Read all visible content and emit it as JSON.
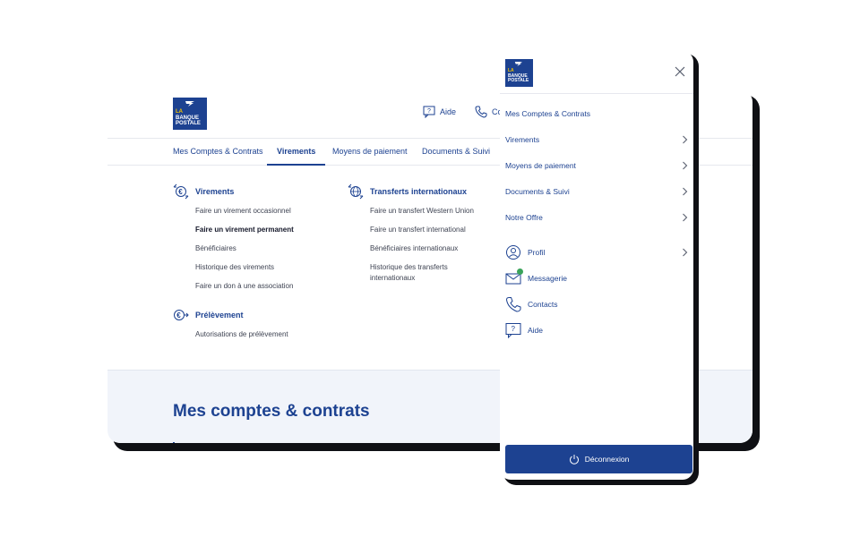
{
  "brand": {
    "logo_line1": "LA",
    "logo_line2": "BANQUE",
    "logo_line3": "POSTALE"
  },
  "desktop": {
    "header": {
      "help_label": "Aide",
      "contacts_label": "Co"
    },
    "nav": [
      {
        "label": "Mes Comptes & Contrats"
      },
      {
        "label": "Virements"
      },
      {
        "label": "Moyens de paiement"
      },
      {
        "label": "Documents & Suivi"
      }
    ],
    "menu": {
      "virements": {
        "title": "Virements",
        "links": [
          "Faire un virement occasionnel",
          "Faire un virement permanent",
          "Bénéficiaires",
          "Historique des virements",
          "Faire un don à une association"
        ]
      },
      "prelevement": {
        "title": "Prélèvement",
        "links": [
          "Autorisations de prélèvement"
        ]
      },
      "international": {
        "title": "Transferts internationaux",
        "links": [
          "Faire un transfert Western Union",
          "Faire un transfert international",
          "Bénéficiaires internationaux",
          "Historique des transferts",
          "internationaux"
        ]
      }
    },
    "section_title": "Mes comptes & contrats"
  },
  "mobile": {
    "items": [
      {
        "label": "Mes Comptes & Contrats"
      },
      {
        "label": "Virements"
      },
      {
        "label": "Moyens de paiement"
      },
      {
        "label": "Documents & Suivi"
      },
      {
        "label": "Notre Offre"
      }
    ],
    "account_items": [
      {
        "label": "Profil",
        "icon": "profile-icon"
      },
      {
        "label": "Messagerie",
        "icon": "mail-icon"
      },
      {
        "label": "Contacts",
        "icon": "phone-icon"
      },
      {
        "label": "Aide",
        "icon": "help-icon"
      }
    ],
    "logout_label": "Déconnexion"
  },
  "colors": {
    "brand_blue": "#1d4291",
    "accent_yellow": "#f2c400",
    "notification_green": "#3aa35a"
  }
}
